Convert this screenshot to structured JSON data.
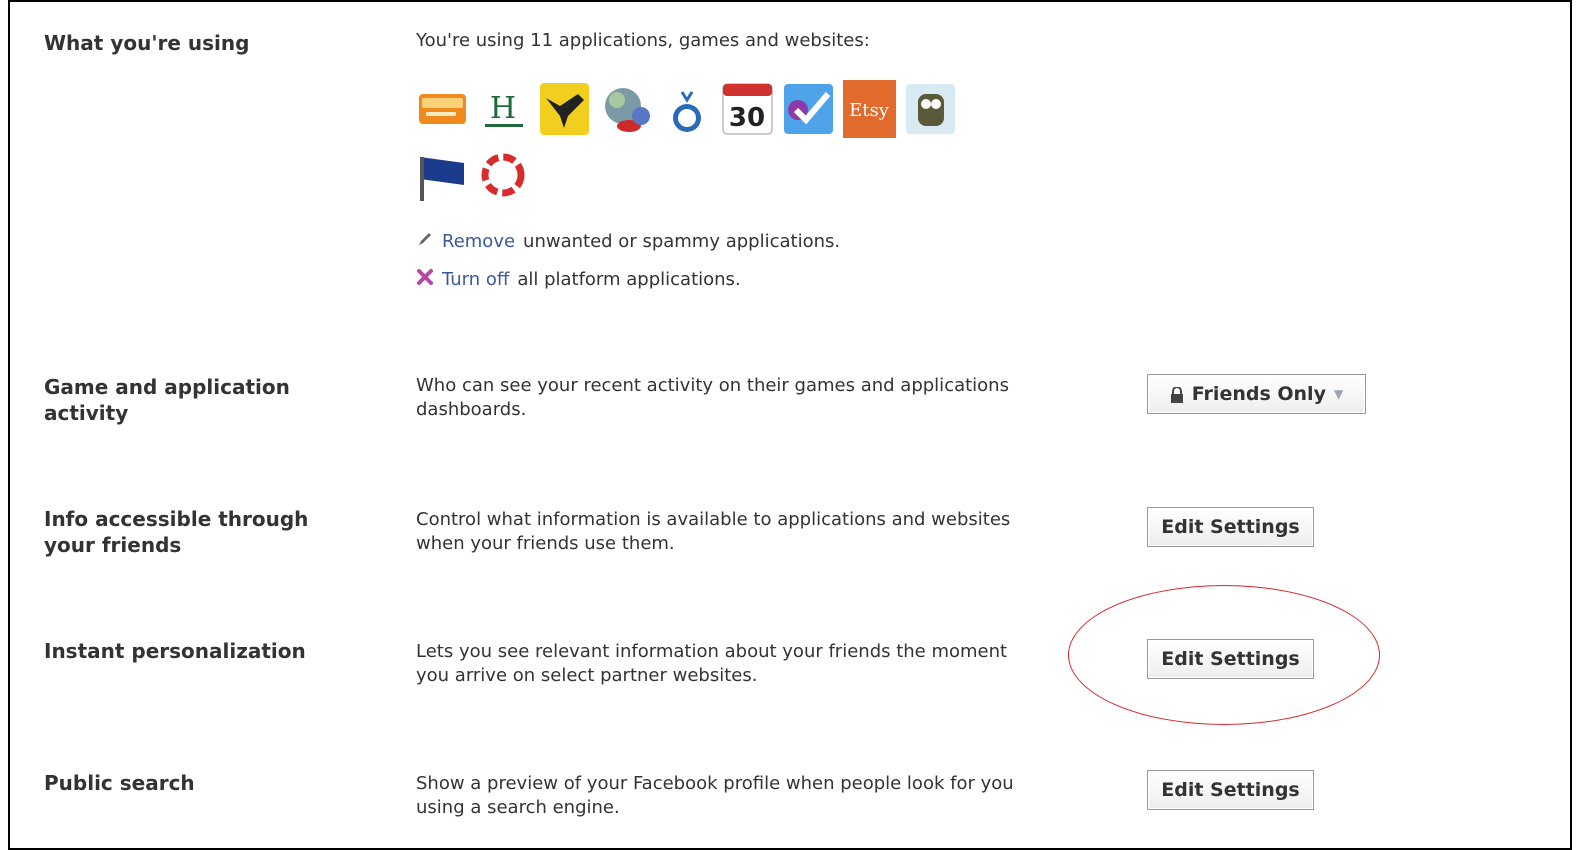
{
  "sections": {
    "using": {
      "label": "What you're using",
      "summary": "You're using 11 applications, games and websites:",
      "apps": [
        {
          "name": "orange-banner-app-icon"
        },
        {
          "name": "h-logo-app-icon"
        },
        {
          "name": "bird-app-icon"
        },
        {
          "name": "globe-app-icon"
        },
        {
          "name": "tv-app-icon"
        },
        {
          "name": "calendar-app-icon",
          "text": "30"
        },
        {
          "name": "checkmark-app-icon"
        },
        {
          "name": "etsy-app-icon",
          "text": "Etsy"
        },
        {
          "name": "owl-app-icon"
        },
        {
          "name": "flag-app-icon"
        },
        {
          "name": "swirl-app-icon"
        }
      ],
      "remove_link": "Remove",
      "remove_rest": "unwanted or spammy applications.",
      "turnoff_link": "Turn off",
      "turnoff_rest": "all platform applications."
    },
    "activity": {
      "label_line1": "Game and application",
      "label_line2": "activity",
      "desc_line1": "Who can see your recent activity on their games and applications",
      "desc_line2": "dashboards.",
      "privacy_value": "Friends Only"
    },
    "friends_info": {
      "label_line1": "Info accessible through",
      "label_line2": "your friends",
      "desc_line1": "Control what information is available to applications and websites",
      "desc_line2": "when your friends use them.",
      "button": "Edit Settings"
    },
    "personalization": {
      "label": "Instant personalization",
      "desc_line1": "Lets you see relevant information about your friends the moment",
      "desc_line2": "you arrive on select partner websites.",
      "button": "Edit Settings"
    },
    "public_search": {
      "label": "Public search",
      "desc_line1": "Show a preview of your Facebook profile when people look for you",
      "desc_line2": "using a search engine.",
      "button": "Edit Settings"
    }
  },
  "colors": {
    "link": "#3b5998",
    "callout": "#d9262a",
    "button_border": "#999999"
  }
}
